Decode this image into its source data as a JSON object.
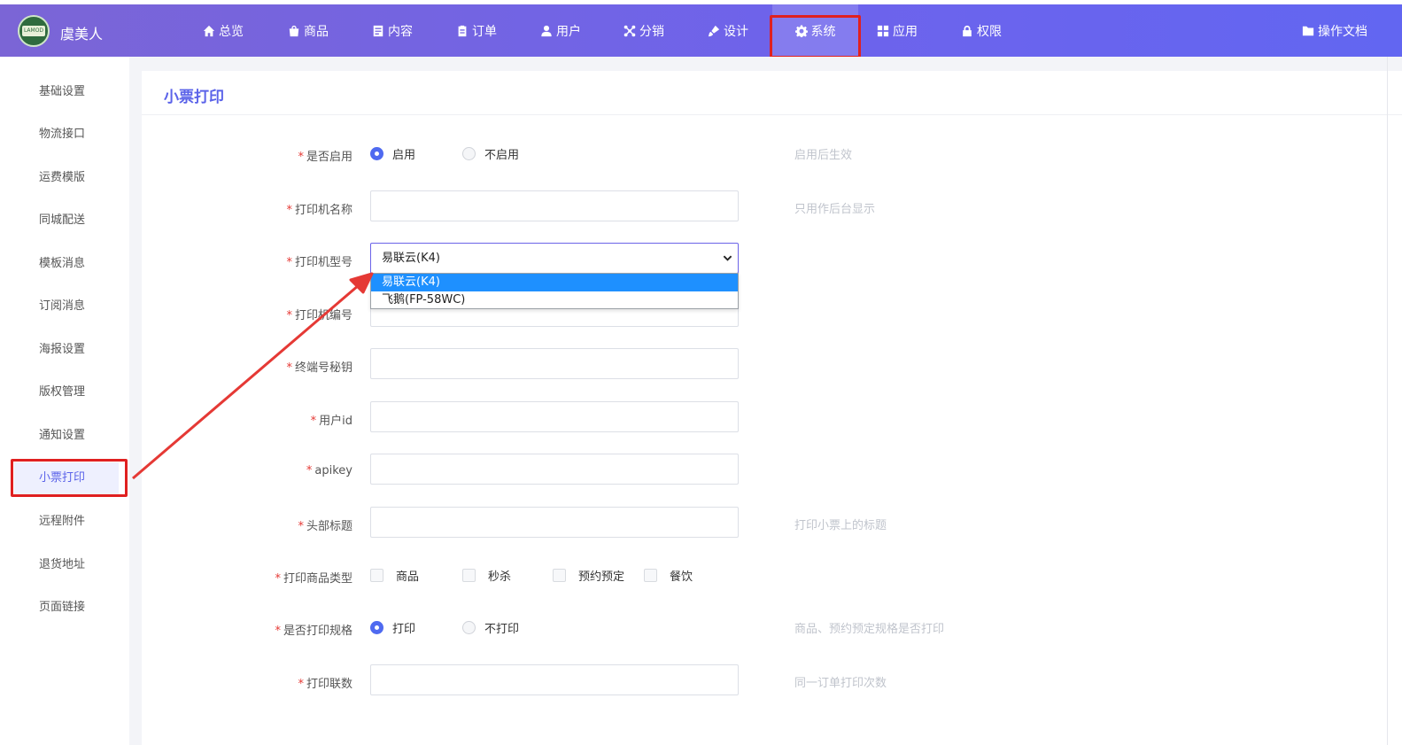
{
  "header": {
    "brand": "虞美人",
    "logo_text": "LAMOD",
    "nav": [
      {
        "label": "总览",
        "icon": "home-icon"
      },
      {
        "label": "商品",
        "icon": "bag-icon"
      },
      {
        "label": "内容",
        "icon": "document-icon"
      },
      {
        "label": "订单",
        "icon": "clipboard-icon"
      },
      {
        "label": "用户",
        "icon": "user-icon"
      },
      {
        "label": "分销",
        "icon": "network-icon"
      },
      {
        "label": "设计",
        "icon": "brush-icon"
      },
      {
        "label": "系统",
        "icon": "gear-icon",
        "active": true
      },
      {
        "label": "应用",
        "icon": "grid-icon"
      },
      {
        "label": "权限",
        "icon": "lock-icon"
      }
    ],
    "docs": {
      "label": "操作文档",
      "icon": "folder-icon"
    }
  },
  "sidebar": {
    "items": [
      {
        "label": "基础设置"
      },
      {
        "label": "物流接口"
      },
      {
        "label": "运费模版"
      },
      {
        "label": "同城配送"
      },
      {
        "label": "模板消息"
      },
      {
        "label": "订阅消息"
      },
      {
        "label": "海报设置"
      },
      {
        "label": "版权管理"
      },
      {
        "label": "通知设置"
      },
      {
        "label": "小票打印",
        "active": true
      },
      {
        "label": "远程附件"
      },
      {
        "label": "退货地址"
      },
      {
        "label": "页面链接"
      }
    ]
  },
  "page": {
    "title": "小票打印"
  },
  "form": {
    "enable": {
      "label": "是否启用",
      "options": [
        "启用",
        "不启用"
      ],
      "selected": "启用",
      "hint": "启用后生效"
    },
    "printer_name": {
      "label": "打印机名称",
      "value": "",
      "hint": "只用作后台显示"
    },
    "printer_model": {
      "label": "打印机型号",
      "value": "易联云(K4)",
      "options": [
        "易联云(K4)",
        "飞鹅(FP-58WC)"
      ]
    },
    "printer_sn": {
      "label": "打印机编号",
      "value": ""
    },
    "terminal_key": {
      "label": "终端号秘钥",
      "value": ""
    },
    "user_id": {
      "label": "用户id",
      "value": ""
    },
    "apikey": {
      "label": "apikey",
      "value": ""
    },
    "header_title": {
      "label": "头部标题",
      "value": "",
      "hint": "打印小票上的标题"
    },
    "goods_type": {
      "label": "打印商品类型",
      "options": [
        "商品",
        "秒杀",
        "预约预定",
        "餐饮"
      ]
    },
    "print_spec": {
      "label": "是否打印规格",
      "options": [
        "打印",
        "不打印"
      ],
      "selected": "打印",
      "hint": "商品、预约预定规格是否打印"
    },
    "copies": {
      "label": "打印联数",
      "value": "",
      "hint": "同一订单打印次数"
    }
  },
  "colors": {
    "accent": "#5b63e9",
    "highlight": "#e02020",
    "required": "#e53935"
  }
}
